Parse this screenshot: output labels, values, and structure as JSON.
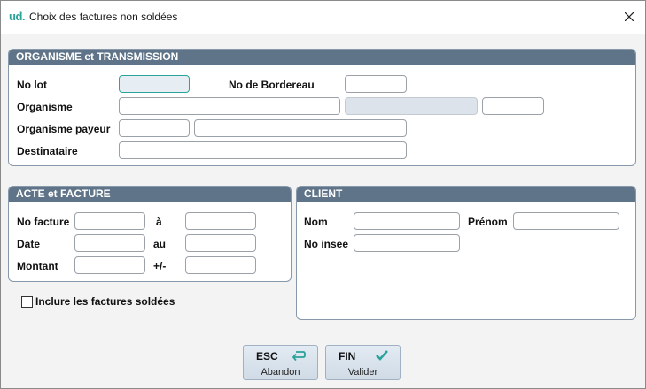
{
  "window": {
    "logo": "ud.",
    "title": "Choix des factures non soldées",
    "accent_color": "#2aa39a",
    "header_color": "#5f7488"
  },
  "organisme": {
    "heading": "ORGANISME et TRANSMISSION",
    "no_lot_label": "No lot",
    "no_lot_value": "",
    "bordereau_label": "No de Bordereau",
    "bordereau_value": "",
    "organisme_label": "Organisme",
    "organisme_value": "",
    "organisme_payeur_label": "Organisme payeur",
    "organisme_payeur_code": "",
    "organisme_payeur_name": "",
    "destinataire_label": "Destinataire",
    "destinataire_value": ""
  },
  "acte": {
    "heading": "ACTE et FACTURE",
    "no_facture_label": "No facture",
    "no_facture_to": "à",
    "date_label": "Date",
    "date_to": "au",
    "montant_label": "Montant",
    "montant_tol": "+/-"
  },
  "client": {
    "heading": "CLIENT",
    "nom_label": "Nom",
    "prenom_label": "Prénom",
    "no_insee_label": "No insee"
  },
  "options": {
    "include_paid_label": "Inclure les factures soldées",
    "include_paid_checked": false
  },
  "buttons": {
    "esc_key": "ESC",
    "esc_label": "Abandon",
    "esc_icon": "return-arrow-icon",
    "fin_key": "FIN",
    "fin_label": "Valider",
    "fin_icon": "checkmark-icon"
  }
}
